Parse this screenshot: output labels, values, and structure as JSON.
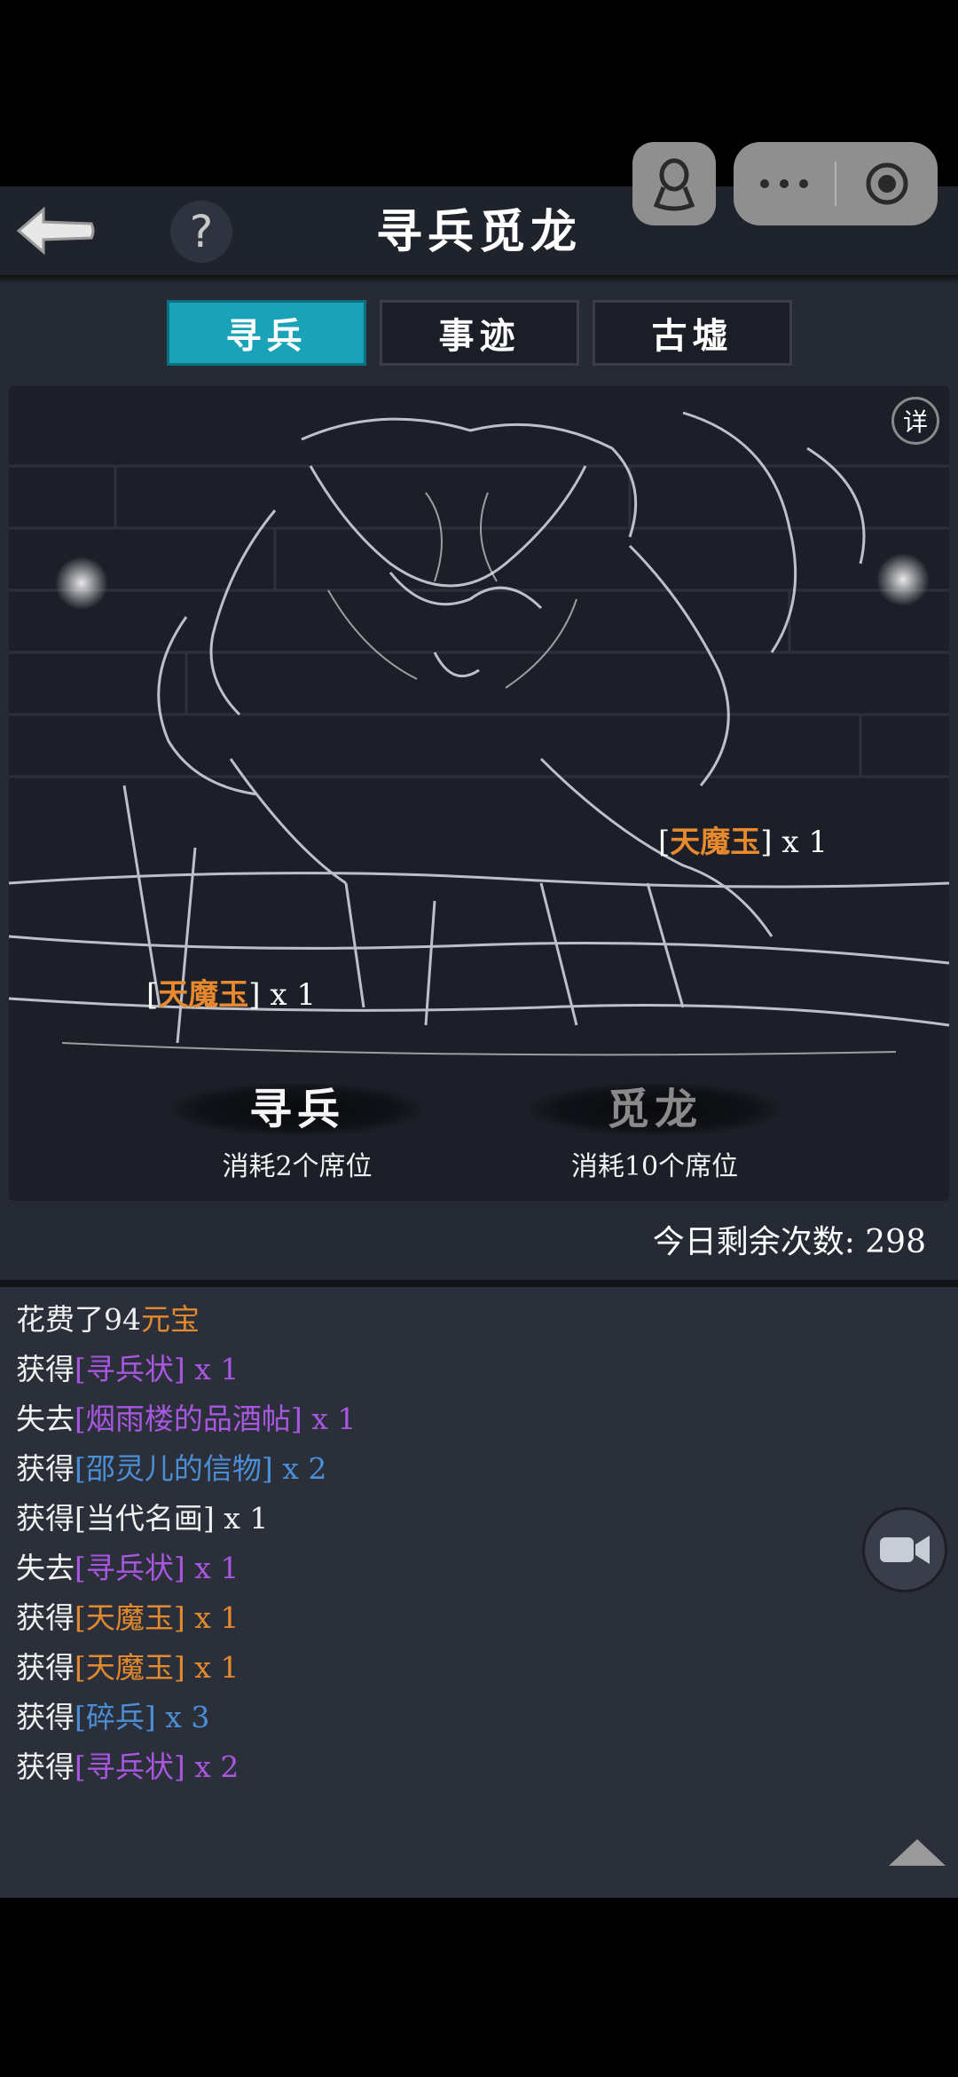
{
  "header": {
    "title": "寻兵觅龙",
    "help_label": "?"
  },
  "tabs": [
    {
      "label": "寻兵",
      "active": true
    },
    {
      "label": "事迹",
      "active": false
    },
    {
      "label": "古墟",
      "active": false
    }
  ],
  "scene": {
    "detail_label": "详",
    "drops": [
      {
        "prefix": "[",
        "item": "天魔玉",
        "suffix": "] x 1"
      },
      {
        "prefix": "[",
        "item": "天魔玉",
        "suffix": "] x 1"
      }
    ],
    "actions": [
      {
        "label": "寻兵",
        "cost": "消耗2个席位",
        "enabled": true
      },
      {
        "label": "觅龙",
        "cost": "消耗10个席位",
        "enabled": false
      }
    ]
  },
  "remaining": "今日剩余次数: 298",
  "log": [
    {
      "pre": "花费了94",
      "item": "元宝",
      "post": "",
      "color": "orange"
    },
    {
      "pre": "获得",
      "item": "[寻兵状] x 1",
      "post": "",
      "color": "purple"
    },
    {
      "pre": "失去",
      "item": "[烟雨楼的品酒帖] x 1",
      "post": "",
      "color": "purple"
    },
    {
      "pre": "获得",
      "item": "[邵灵儿的信物] x 2",
      "post": "",
      "color": "blue"
    },
    {
      "pre": "获得",
      "item": "[当代名画] x 1",
      "post": "",
      "color": "white"
    },
    {
      "pre": "失去",
      "item": "[寻兵状] x 1",
      "post": "",
      "color": "purple"
    },
    {
      "pre": "获得",
      "item": "[天魔玉] x 1",
      "post": "",
      "color": "orange"
    },
    {
      "pre": "获得",
      "item": "[天魔玉] x 1",
      "post": "",
      "color": "orange"
    },
    {
      "pre": "获得",
      "item": "[碎兵] x 3",
      "post": "",
      "color": "blue"
    },
    {
      "pre": "获得",
      "item": "[寻兵状] x 2",
      "post": "",
      "color": "purple"
    }
  ],
  "colors": {
    "accent_tab": "#1aa3b8",
    "orange": "#e48a2e",
    "purple": "#a857e0",
    "blue": "#4b8fd6"
  },
  "icons": {
    "back": "arrow-left-icon",
    "help": "question-icon",
    "user": "person-pin-icon",
    "more": "more-dots-icon",
    "record": "record-icon",
    "camera": "video-camera-icon",
    "scroll_up": "triangle-up-icon"
  }
}
